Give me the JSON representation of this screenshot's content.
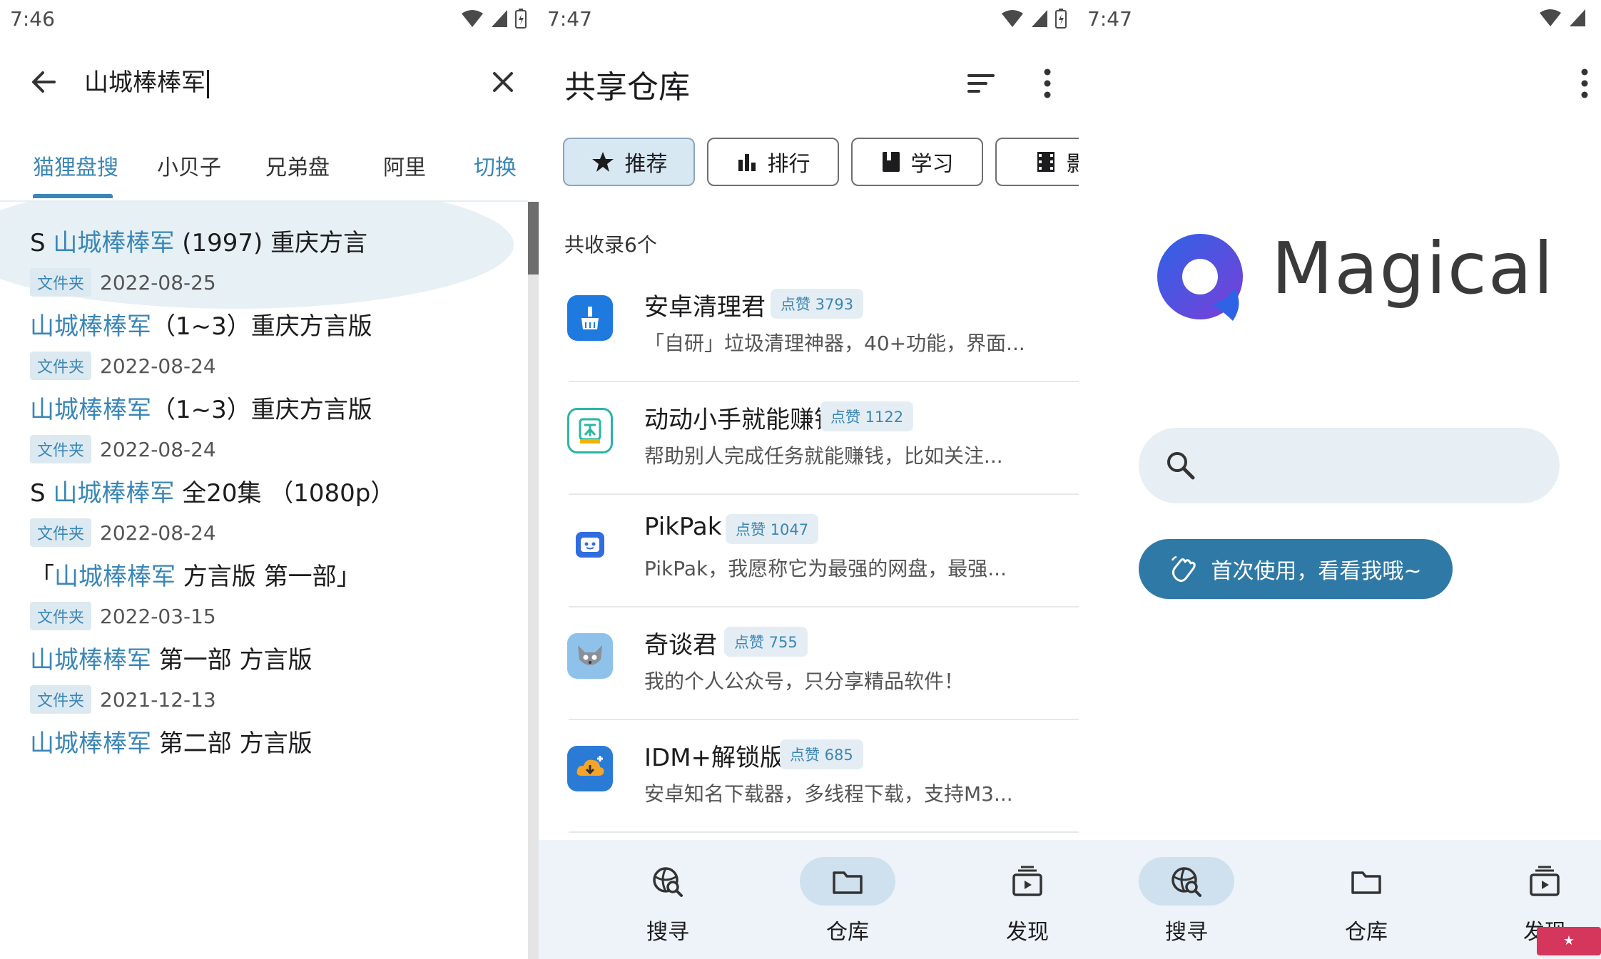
{
  "colors": {
    "accent": "#3a86b6",
    "button": "#2f79a6",
    "nav_bg": "#edf3f8"
  },
  "panel1": {
    "status_time": "7:46",
    "search_value": "山城棒棒军",
    "tabs": [
      "猫狸盘搜",
      "小贝子",
      "兄弟盘",
      "阿里",
      "切换"
    ],
    "results": [
      {
        "pre": "S ",
        "hl": "山城棒棒军",
        "post": " (1997) 重庆方言",
        "badge": "文件夹",
        "date": "2022-08-25"
      },
      {
        "pre": "",
        "hl": "山城棒棒军",
        "post": "（1~3）重庆方言版",
        "badge": "文件夹",
        "date": "2022-08-24"
      },
      {
        "pre": "",
        "hl": "山城棒棒军",
        "post": "（1~3）重庆方言版",
        "badge": "文件夹",
        "date": "2022-08-24"
      },
      {
        "pre": "S ",
        "hl": "山城棒棒军",
        "post": " 全20集 （1080p）",
        "badge": "文件夹",
        "date": "2022-08-24"
      },
      {
        "pre": "「",
        "hl": "山城棒棒军",
        "post": "  方言版  第一部」",
        "badge": "文件夹",
        "date": "2022-03-15"
      },
      {
        "pre": "",
        "hl": "山城棒棒军",
        "post": " 第一部 方言版",
        "badge": "文件夹",
        "date": "2021-12-13"
      },
      {
        "pre": "",
        "hl": "山城棒棒军",
        "post": " 第二部 方言版",
        "badge": "",
        "date": ""
      }
    ]
  },
  "panel2": {
    "status_time": "7:47",
    "title": "共享仓库",
    "chips": [
      "推荐",
      "排行",
      "学习",
      "影"
    ],
    "count_text": "共收录6个",
    "apps": [
      {
        "name": "安卓清理君",
        "likes": "点赞 3793",
        "desc": "「自研」垃圾清理神器，40+功能，界面...",
        "icon": "broom-icon",
        "color": "#1f7ae0"
      },
      {
        "name": "动动小手就能赚钱",
        "likes": "点赞 1122",
        "desc": "帮助别人完成任务就能赚钱，比如关注...",
        "icon": "xian-icon",
        "color": "#2ab5a6"
      },
      {
        "name": "PikPak",
        "likes": "点赞 1047",
        "desc": "PikPak，我愿称它为最强的网盘，最强...",
        "icon": "robot-icon",
        "color": "#2f6de0"
      },
      {
        "name": "奇谈君",
        "likes": "点赞 755",
        "desc": "我的个人公众号，只分享精品软件！",
        "icon": "cat-icon",
        "color": "#7fb6e0"
      },
      {
        "name": "IDM+解锁版",
        "likes": "点赞 685",
        "desc": "安卓知名下载器，多线程下载，支持M3...",
        "icon": "download-cloud-icon",
        "color": "#2a7bd6"
      }
    ],
    "nav": [
      {
        "label": "搜寻",
        "icon": "globe-search-icon",
        "active": false
      },
      {
        "label": "仓库",
        "icon": "folder-icon",
        "active": true
      },
      {
        "label": "发现",
        "icon": "play-box-icon",
        "active": false
      }
    ]
  },
  "panel3": {
    "status_time": "7:47",
    "logo_text": "Magical",
    "first_use_label": "首次使用，看看我哦~",
    "nav": [
      {
        "label": "搜寻",
        "icon": "globe-search-icon",
        "active": true
      },
      {
        "label": "仓库",
        "icon": "folder-icon",
        "active": false
      },
      {
        "label": "发现",
        "icon": "play-box-icon",
        "active": false
      }
    ]
  }
}
